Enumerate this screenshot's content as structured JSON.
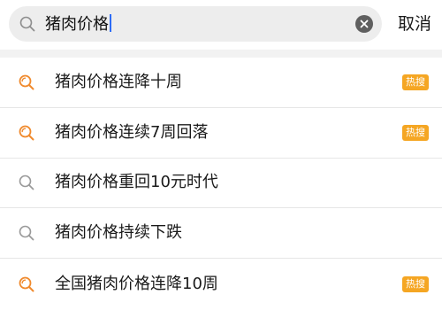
{
  "search": {
    "query": "猪肉价格",
    "cancel_label": "取消"
  },
  "colors": {
    "accent_hot": "#f5a623",
    "search_bg": "#ededed",
    "hot_icon": "#f08a2d"
  },
  "suggestions": [
    {
      "label": "猪肉价格连降十周",
      "icon": "hot-search-icon",
      "badge": "热搜"
    },
    {
      "label": "猪肉价格连续7周回落",
      "icon": "hot-search-icon",
      "badge": "热搜"
    },
    {
      "label": "猪肉价格重回10元时代",
      "icon": "search-icon",
      "badge": ""
    },
    {
      "label": "猪肉价格持续下跌",
      "icon": "search-icon",
      "badge": ""
    },
    {
      "label": "全国猪肉价格连降10周",
      "icon": "hot-search-icon",
      "badge": "热搜"
    }
  ]
}
